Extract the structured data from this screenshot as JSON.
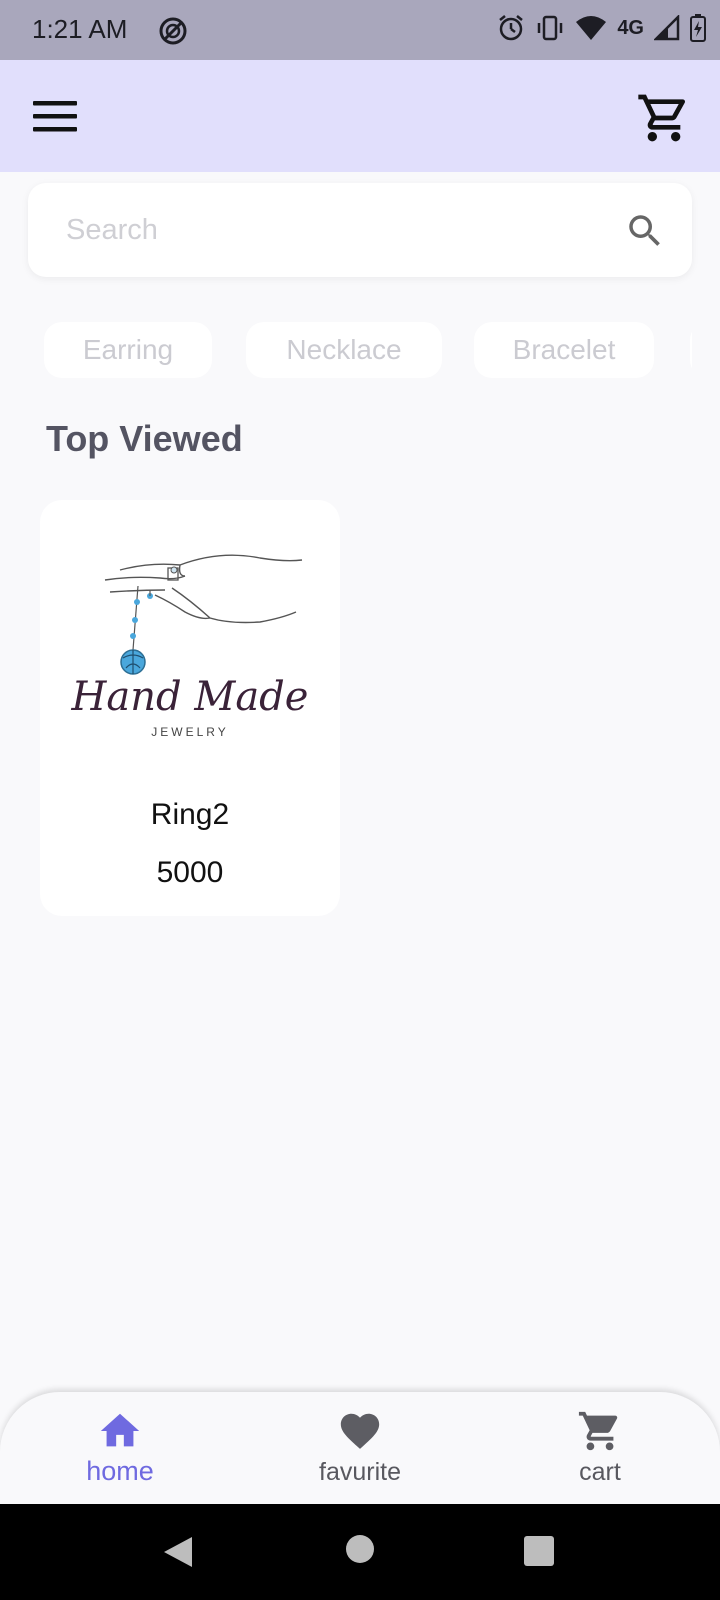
{
  "status_bar": {
    "time": "1:21 AM",
    "network": "4G",
    "icons": [
      "do-not-disturb-icon",
      "alarm-icon",
      "vibrate-icon",
      "wifi-icon",
      "signal-icon",
      "battery-icon"
    ]
  },
  "app_bar": {
    "icons": [
      "menu-icon",
      "cart-icon"
    ]
  },
  "search": {
    "placeholder": "Search",
    "value": ""
  },
  "categories": [
    "Earring",
    "Necklace",
    "Bracelet"
  ],
  "section": {
    "title": "Top Viewed"
  },
  "products": [
    {
      "logo_text": "Hand Made",
      "logo_subtext": "JEWELRY",
      "name": "Ring2",
      "price": "5000"
    }
  ],
  "bottom_nav": {
    "items": [
      {
        "label": "home",
        "icon": "home-icon",
        "active": true
      },
      {
        "label": "favurite",
        "icon": "heart-icon",
        "active": false
      },
      {
        "label": "cart",
        "icon": "cart-icon",
        "active": false
      }
    ]
  },
  "colors": {
    "app_bar_bg": "#e1dffc",
    "accent": "#6f6ae0",
    "status_bar_bg": "#a9a7bc",
    "page_bg": "#f9f9fb"
  }
}
